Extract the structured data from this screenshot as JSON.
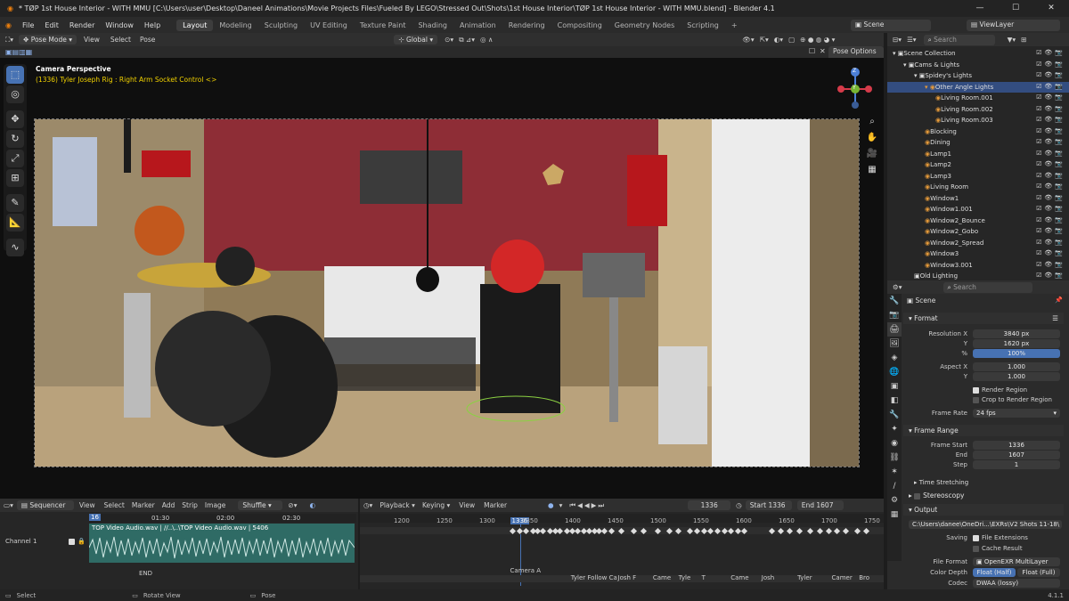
{
  "window": {
    "title": "* TØP 1st House Interior - WITH MMU [C:\\Users\\user\\Desktop\\Daneel Animations\\Movie Projects Files\\Fueled By LEGO\\Stressed Out\\Shots\\1st House Interior\\TØP 1st House Interior - WITH MMU.blend] - Blender 4.1",
    "minimize": "—",
    "maximize": "☐",
    "close": "✕"
  },
  "menu": {
    "items": [
      "File",
      "Edit",
      "Render",
      "Window",
      "Help"
    ],
    "workspaces": [
      "Layout",
      "Modeling",
      "Sculpting",
      "UV Editing",
      "Texture Paint",
      "Shading",
      "Animation",
      "Rendering",
      "Compositing",
      "Geometry Nodes",
      "Scripting"
    ],
    "add": "+",
    "scene": "Scene",
    "view_layer": "ViewLayer"
  },
  "viewport": {
    "mode": "Pose Mode",
    "menus": [
      "View",
      "Select",
      "Pose"
    ],
    "transform": "Global",
    "pose_options": "Pose Options",
    "overlay_title": "Camera Perspective",
    "overlay_sub": "(1336) Tyler Joseph Rig : Right Arm Socket Control <>",
    "gizmo": {
      "z": "Z",
      "y": "Y",
      "x": "X"
    }
  },
  "outliner": {
    "search": "Search",
    "rows": [
      {
        "label": "Scene Collection",
        "indent": 0
      },
      {
        "label": "Cams & Lights",
        "indent": 1
      },
      {
        "label": "Spidey's Lights",
        "indent": 2
      },
      {
        "label": "Other Angle Lights",
        "indent": 3,
        "selected": true
      },
      {
        "label": "Living Room.001",
        "indent": 4
      },
      {
        "label": "Living Room.002",
        "indent": 4
      },
      {
        "label": "Living Room.003",
        "indent": 4
      },
      {
        "label": "Blocking",
        "indent": 3
      },
      {
        "label": "Dining",
        "indent": 3
      },
      {
        "label": "Lamp1",
        "indent": 3
      },
      {
        "label": "Lamp2",
        "indent": 3
      },
      {
        "label": "Lamp3",
        "indent": 3
      },
      {
        "label": "Living Room",
        "indent": 3
      },
      {
        "label": "Window1",
        "indent": 3
      },
      {
        "label": "Window1.001",
        "indent": 3
      },
      {
        "label": "Window2_Bounce",
        "indent": 3
      },
      {
        "label": "Window2_Gobo",
        "indent": 3
      },
      {
        "label": "Window2_Spread",
        "indent": 3
      },
      {
        "label": "Window3",
        "indent": 3
      },
      {
        "label": "Window3.001",
        "indent": 3
      },
      {
        "label": "Old Lighting",
        "indent": 2
      }
    ]
  },
  "properties": {
    "search": "Search",
    "scene": "Scene",
    "format": {
      "title": "Format",
      "res_x_label": "Resolution X",
      "res_x": "3840 px",
      "res_y_label": "Y",
      "res_y": "1620 px",
      "pct_label": "%",
      "pct": "100%",
      "aspect_x_label": "Aspect X",
      "aspect_x": "1.000",
      "aspect_y_label": "Y",
      "aspect_y": "1.000",
      "render_region": "Render Region",
      "crop": "Crop to Render Region",
      "frame_rate_label": "Frame Rate",
      "frame_rate": "24 fps"
    },
    "frame_range": {
      "title": "Frame Range",
      "start_label": "Frame Start",
      "start": "1336",
      "end_label": "End",
      "end": "1607",
      "step_label": "Step",
      "step": "1"
    },
    "time_stretching": "Time Stretching",
    "stereoscopy": "Stereoscopy",
    "output": {
      "title": "Output",
      "path": "C:\\Users\\danee\\OneDri...\\EXRs\\V2 Shots 11-18\\",
      "saving_label": "Saving",
      "file_ext": "File Extensions",
      "cache": "Cache Result",
      "file_format_label": "File Format",
      "file_format": "OpenEXR MultiLayer",
      "color_depth_label": "Color Depth",
      "depth_half": "Float (Half)",
      "depth_full": "Float (Full)",
      "codec_label": "Codec",
      "codec": "DWAA (lossy)"
    }
  },
  "sequencer": {
    "title": "Sequencer",
    "menus": [
      "View",
      "Select",
      "Marker",
      "Add",
      "Strip",
      "Image"
    ],
    "shuffle": "Shuffle",
    "channel": "Channel 1",
    "strip": "TOP Video Audio.wav | //..\\..\\TOP Video Audio.wav | 5406",
    "end_label": "END",
    "current": "16",
    "times": [
      "01:30",
      "02:00",
      "02:30"
    ]
  },
  "timeline": {
    "menus": [
      "Playback",
      "Keying",
      "View",
      "Marker"
    ],
    "frame": "1336",
    "start_label": "Start",
    "start": "1336",
    "end_label": "End",
    "end": "1607",
    "ticks": [
      "1200",
      "1250",
      "1300",
      "1336",
      "1350",
      "1400",
      "1450",
      "1500",
      "1550",
      "1600",
      "1650",
      "1700",
      "1750"
    ],
    "markers": [
      "Camera A",
      "Tyler Follow Ca",
      "Josh F",
      "Came",
      "Tyle",
      "T",
      "Came",
      "Josh",
      "Tyler",
      "Camer",
      "Bro"
    ]
  },
  "status": {
    "select": "Select",
    "rotate": "Rotate View",
    "pose": "Pose",
    "version": "4.1.1"
  },
  "colors": {
    "accent": "#4772b3",
    "selected_row": "#334d80",
    "bg": "#1d1d1d"
  }
}
